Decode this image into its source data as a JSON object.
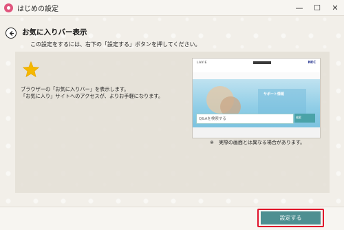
{
  "window": {
    "title": "はじめの設定",
    "icons": {
      "app": "app-icon",
      "minimize": "minimize-icon",
      "maximize": "maximize-icon",
      "close": "close-icon"
    }
  },
  "header": {
    "title": "お気に入りバー表示",
    "subtitle": "この設定をするには、右下の「設定する」ボタンを押してください。",
    "back_icon": "back-arrow-icon"
  },
  "content": {
    "icon": "star-icon",
    "star_color": "#f5b800",
    "description_line1": "ブラウザーの「お気に入りバー」を表示します。",
    "description_line2": "「お気に入り」サイトへのアクセスが、よりお手軽になります。",
    "preview": {
      "logo": "LAVIE",
      "brand": "NEC",
      "hero_title": "サポート情報",
      "search_placeholder": "Q&Aを検索する",
      "search_button": "検索"
    },
    "caption": "※　実際の画面とは異なる場合があります。"
  },
  "footer": {
    "setup_button": "設定する",
    "accent_color": "#4e8f91",
    "highlight_color": "#e0102a"
  }
}
